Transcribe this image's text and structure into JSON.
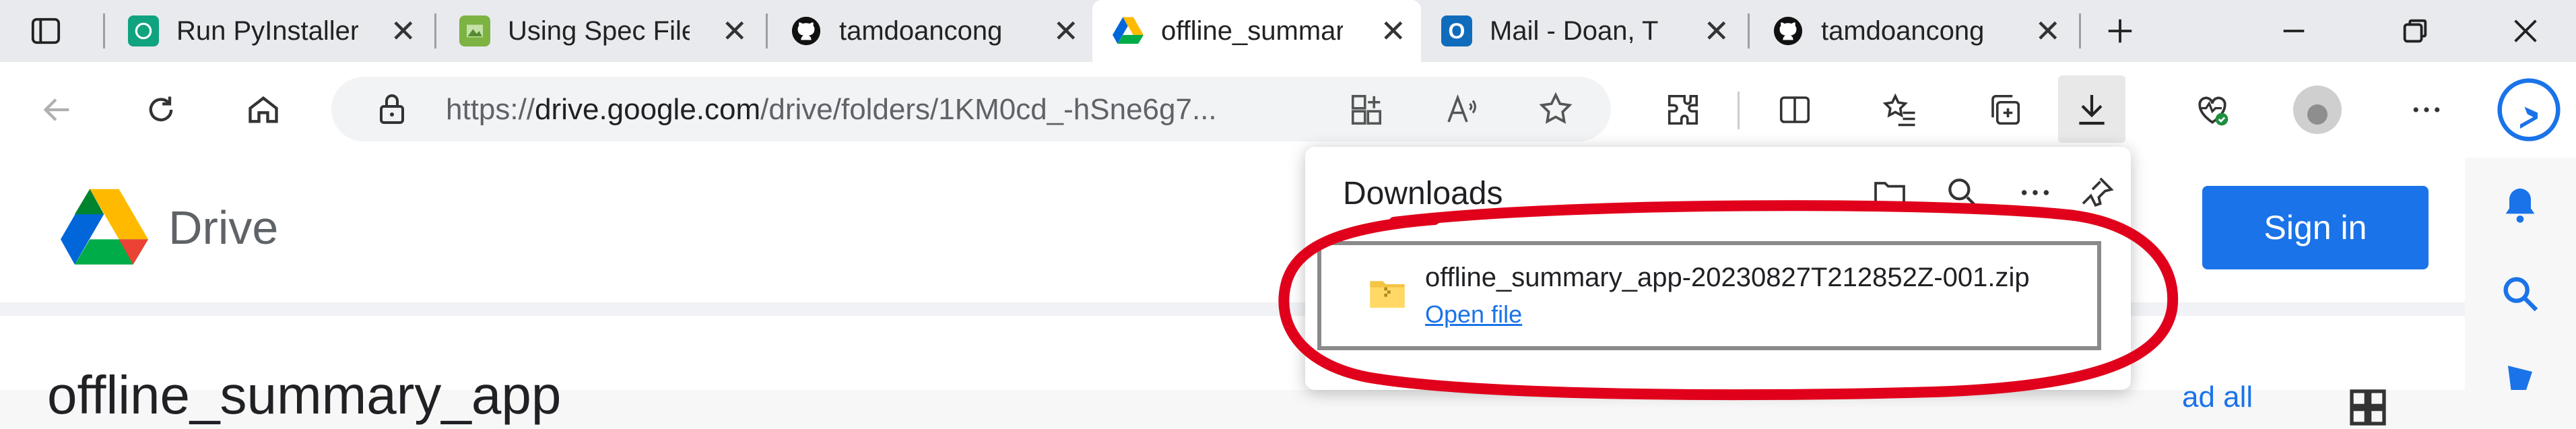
{
  "tabs": [
    {
      "title": "Run PyInstaller",
      "icon": "chatgpt-icon"
    },
    {
      "title": "Using Spec Files",
      "icon": "image-icon"
    },
    {
      "title": "tamdoancong",
      "icon": "github-icon"
    },
    {
      "title": "offline_summary",
      "icon": "google-drive-icon"
    },
    {
      "title": "Mail - Doan, T",
      "icon": "outlook-icon"
    },
    {
      "title": "tamdoancong",
      "icon": "github-icon"
    }
  ],
  "address": {
    "prefix": "https://",
    "domain": "drive.google.com",
    "path": "/drive/folders/1KM0cd_-hSne6g7..."
  },
  "drive": {
    "brand": "Drive",
    "sign_in": "Sign in",
    "folder_name": "offline_summary_app",
    "read_all": "ad all"
  },
  "downloads": {
    "title": "Downloads",
    "file_name": "offline_summary_app-20230827T212852Z-001.zip",
    "open_file": "Open file"
  },
  "colors": {
    "accent": "#1a73e8",
    "annotation": "#e0001b",
    "tab_strip": "#e8eaed"
  }
}
